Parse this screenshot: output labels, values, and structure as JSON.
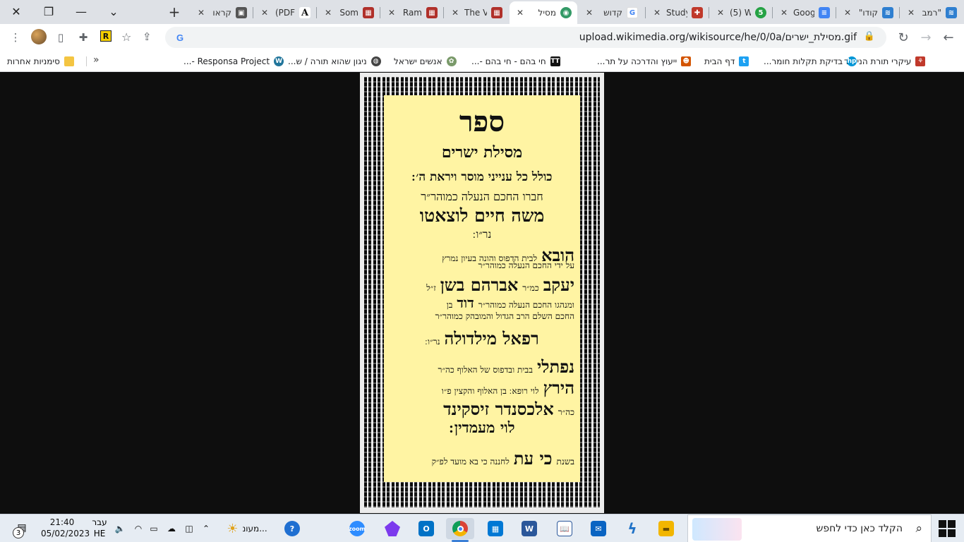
{
  "window": {
    "close_glyph": "✕",
    "restore_glyph": "❐",
    "minimize_glyph": "—",
    "tab_search_glyph": "⌄"
  },
  "tabs": [
    {
      "title": "רמב\"",
      "favicon": "hebrewbooks-icon",
      "color": "#2f7fd0"
    },
    {
      "title": "\"קודו",
      "favicon": "hebrewbooks-icon",
      "color": "#2f7fd0"
    },
    {
      "title": "Goog",
      "favicon": "google-docs-icon",
      "color": "#4285f4"
    },
    {
      "title": "(5) W",
      "favicon": "whatsapp-icon",
      "color": "#25a244"
    },
    {
      "title": "Study",
      "favicon": "shield-icon",
      "color": "#c0392b"
    },
    {
      "title": "קדוש",
      "favicon": "google-icon",
      "color": "#4285f4"
    },
    {
      "title": "מסיל",
      "favicon": "wikisource-icon",
      "color": "#339966",
      "active": true
    },
    {
      "title": "The V",
      "favicon": "book-icon",
      "color": "#b0302a"
    },
    {
      "title": "Ram",
      "favicon": "book-icon",
      "color": "#b0302a"
    },
    {
      "title": "Som",
      "favicon": "book-icon",
      "color": "#b0302a"
    },
    {
      "title": "(PDF",
      "favicon": "academia-icon",
      "color": "#222222"
    },
    {
      "title": "קראו",
      "favicon": "image-icon",
      "color": "#555555"
    }
  ],
  "toolbar": {
    "url": "upload.wikimedia.org/wikisource/he/0/0a/מסילת_ישרים.gif",
    "back_glyph": "←",
    "forward_glyph": "→",
    "reload_glyph": "↻",
    "lock_glyph": "🔒",
    "star_glyph": "☆",
    "share_glyph": "⇪",
    "menu_glyph": "⋮",
    "extensions_glyph": "✚",
    "sidepanel_glyph": "▯",
    "ext_r_label": "R"
  },
  "bookmarks": [
    {
      "label": "עיקרי תורת הניקוד",
      "icon": "tree-icon",
      "color": "#c0392b"
    },
    {
      "label": "בדיקת תקלות חומר...",
      "icon": "hp-icon",
      "color": "#0096d6"
    },
    {
      "label": "דף הבית",
      "icon": "twitter-icon",
      "color": "#1da1f2"
    },
    {
      "label": "ייעוץ והדרכה על תר...",
      "icon": "person-icon",
      "color": "#d35400"
    },
    {
      "label": "חי בהם - חי בהם -...",
      "icon": "tt-icon",
      "color": "#111111"
    },
    {
      "label": "אנשים ישראל",
      "icon": "leaf-icon",
      "color": "#7a9a6a"
    },
    {
      "label": "ניגון שהוא תורה / ש...",
      "icon": "globe-icon",
      "color": "#444444"
    },
    {
      "label": "Responsa Project -...",
      "icon": "wordpress-icon",
      "color": "#21759b"
    }
  ],
  "bookmarks_more": "»",
  "other_bookmarks": "סימניות אחרות",
  "document": {
    "title": "ספר",
    "subtitle": "מסילת ישרים",
    "line3": "כולל כל ענייני מוסר ויראת ה׳ ׃",
    "line4": "חברו החכם הנעלה כמוהר״ר",
    "author": "משה חיים לוצאטו",
    "author_suffix": "נר״ו ׃",
    "r7_big": "הובא",
    "r7_small": "לבית הדפוס והונה בעיון נמרץ",
    "r8_small": "על ידי החכם הנעלה כמוהר״ר",
    "r9_big": "יעקב",
    "r9_small1": "כמ״ר",
    "r9_big2": "אברהם בשן",
    "r9_small2": "ז״ל",
    "r10_small": "ומנהגו החכם הנעלה כמוהר״ר",
    "r10_big": "דוד",
    "r10_small2": "בן",
    "r11_small": "החכם השלם הרב הגדול והמובהק כמוהר״ר",
    "r12_big": "רפאל מילדולה",
    "r12_small": "נר״ו ׃",
    "r13_big": "נפתלי",
    "r13_small": "בבית ובדפוס של האלוף כה״ר",
    "r14_big": "הירץ",
    "r14_small": "לוי רופא ׃  בן האלוף והקצין פ״ו",
    "r15_small": "כה״ר",
    "r15_big": "אלכסנדר זיסקינד",
    "line16": "לוי מעמדין ׃",
    "r17_small": "בשנת",
    "r17_big": "כי עת",
    "r17_small2": "לחננה כי בא מועד לפ״ק"
  },
  "taskbar": {
    "search_placeholder": "הקלד כאן כדי לחפש",
    "weather_label": "מעונ...",
    "lang_line1": "עבר",
    "lang_line2": "HE",
    "time": "21:40",
    "date": "05/02/2023",
    "notification_count": "3",
    "apps": [
      {
        "name": "file-explorer-icon",
        "color": "#f2b600"
      },
      {
        "name": "solitaire-icon",
        "color": "#1f72c7"
      },
      {
        "name": "mail-icon",
        "color": "#0a64c2"
      },
      {
        "name": "reader-icon",
        "color": "#2b579a"
      },
      {
        "name": "word-icon",
        "color": "#2b579a"
      },
      {
        "name": "store-icon",
        "color": "#0078d4"
      },
      {
        "name": "chrome-icon",
        "color": "#db4437"
      },
      {
        "name": "outlook-icon",
        "color": "#0072c6"
      },
      {
        "name": "obsidian-icon",
        "color": "#7c3aed"
      },
      {
        "name": "zoom-icon",
        "color": "#2d8cff"
      }
    ]
  }
}
